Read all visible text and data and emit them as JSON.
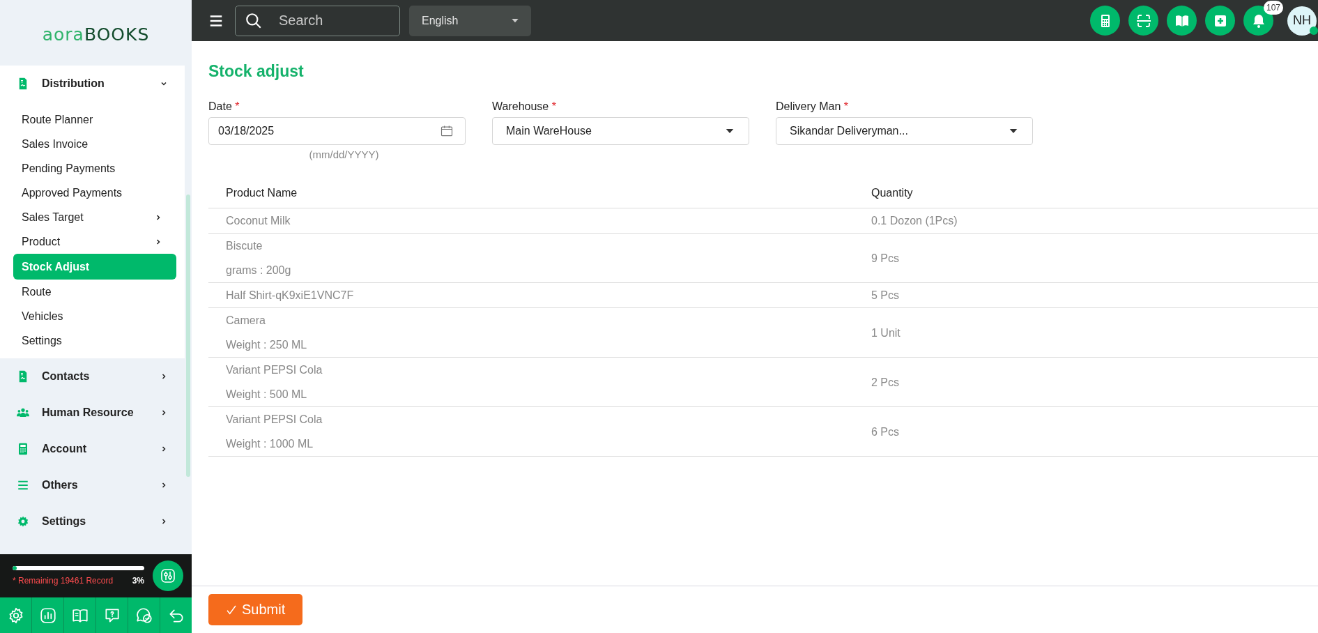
{
  "sidebar": {
    "logo": {
      "left": "aora",
      "right": "BOOKS"
    },
    "groups": [
      {
        "label": "Distribution",
        "expanded": true,
        "children": [
          {
            "label": "Route Planner",
            "selected": false,
            "expandable": false
          },
          {
            "label": "Sales Invoice",
            "selected": false,
            "expandable": false
          },
          {
            "label": "Pending Payments",
            "selected": false,
            "expandable": false
          },
          {
            "label": "Approved Payments",
            "selected": false,
            "expandable": false
          },
          {
            "label": "Sales Target",
            "selected": false,
            "expandable": true
          },
          {
            "label": "Product",
            "selected": false,
            "expandable": true
          },
          {
            "label": "Stock Adjust",
            "selected": true,
            "expandable": false
          },
          {
            "label": "Route",
            "selected": false,
            "expandable": false
          },
          {
            "label": "Vehicles",
            "selected": false,
            "expandable": false
          },
          {
            "label": "Settings",
            "selected": false,
            "expandable": false
          }
        ]
      },
      {
        "label": "Contacts",
        "expanded": false
      },
      {
        "label": "Human Resource",
        "expanded": false
      },
      {
        "label": "Account",
        "expanded": false
      },
      {
        "label": "Others",
        "expanded": false
      },
      {
        "label": "Settings",
        "expanded": false
      }
    ],
    "usage": {
      "level": 0.03,
      "text": "* Remaining 19461 Record",
      "percent": "3%"
    }
  },
  "topbar": {
    "search": {
      "placeholder": "Search"
    },
    "language": "English",
    "notifications": "107",
    "avatar": "NH",
    "online": true
  },
  "page": {
    "title": "Stock adjust",
    "fields": [
      {
        "kind": "date",
        "label": "Date",
        "required_mark": "*",
        "value": "03/18/2025",
        "hint": "(mm/dd/YYYY)"
      },
      {
        "kind": "select",
        "label": "Warehouse",
        "required_mark": "*",
        "value": "Main WareHouse"
      },
      {
        "kind": "select",
        "label": "Delivery Man",
        "required_mark": "*",
        "value": "Sikandar Deliveryman..."
      }
    ],
    "table": {
      "columns": [
        "Product Name",
        "Quantity"
      ],
      "rows": [
        {
          "name": "Coconut Milk",
          "quantity": "0.1 Dozon (1Pcs)"
        },
        {
          "name": "Biscute",
          "detail": "grams : 200g",
          "quantity": "9 Pcs"
        },
        {
          "name": "Half Shirt-qK9xiE1VNC7F",
          "quantity": "5 Pcs"
        },
        {
          "name": "Camera",
          "detail": "Weight : 250 ML",
          "quantity": "1 Unit"
        },
        {
          "name": "Variant PEPSI Cola",
          "detail": "Weight : 500 ML",
          "quantity": "2 Pcs"
        },
        {
          "name": "Variant PEPSI Cola",
          "detail": "Weight : 1000 ML",
          "quantity": "6 Pcs"
        }
      ]
    },
    "submit": "Submit"
  }
}
